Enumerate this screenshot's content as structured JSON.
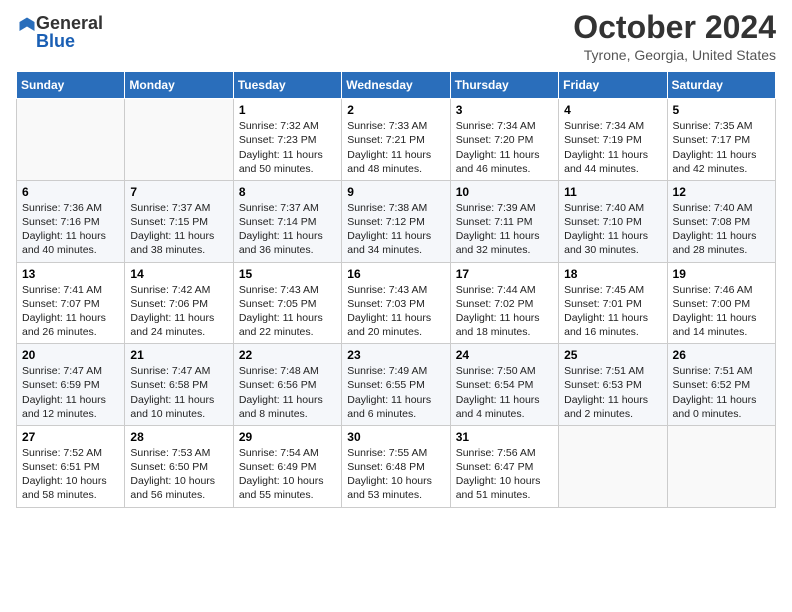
{
  "header": {
    "logo_general": "General",
    "logo_blue": "Blue",
    "month_title": "October 2024",
    "location": "Tyrone, Georgia, United States"
  },
  "days_of_week": [
    "Sunday",
    "Monday",
    "Tuesday",
    "Wednesday",
    "Thursday",
    "Friday",
    "Saturday"
  ],
  "weeks": [
    [
      {
        "day": "",
        "info": ""
      },
      {
        "day": "",
        "info": ""
      },
      {
        "day": "1",
        "info": "Sunrise: 7:32 AM\nSunset: 7:23 PM\nDaylight: 11 hours and 50 minutes."
      },
      {
        "day": "2",
        "info": "Sunrise: 7:33 AM\nSunset: 7:21 PM\nDaylight: 11 hours and 48 minutes."
      },
      {
        "day": "3",
        "info": "Sunrise: 7:34 AM\nSunset: 7:20 PM\nDaylight: 11 hours and 46 minutes."
      },
      {
        "day": "4",
        "info": "Sunrise: 7:34 AM\nSunset: 7:19 PM\nDaylight: 11 hours and 44 minutes."
      },
      {
        "day": "5",
        "info": "Sunrise: 7:35 AM\nSunset: 7:17 PM\nDaylight: 11 hours and 42 minutes."
      }
    ],
    [
      {
        "day": "6",
        "info": "Sunrise: 7:36 AM\nSunset: 7:16 PM\nDaylight: 11 hours and 40 minutes."
      },
      {
        "day": "7",
        "info": "Sunrise: 7:37 AM\nSunset: 7:15 PM\nDaylight: 11 hours and 38 minutes."
      },
      {
        "day": "8",
        "info": "Sunrise: 7:37 AM\nSunset: 7:14 PM\nDaylight: 11 hours and 36 minutes."
      },
      {
        "day": "9",
        "info": "Sunrise: 7:38 AM\nSunset: 7:12 PM\nDaylight: 11 hours and 34 minutes."
      },
      {
        "day": "10",
        "info": "Sunrise: 7:39 AM\nSunset: 7:11 PM\nDaylight: 11 hours and 32 minutes."
      },
      {
        "day": "11",
        "info": "Sunrise: 7:40 AM\nSunset: 7:10 PM\nDaylight: 11 hours and 30 minutes."
      },
      {
        "day": "12",
        "info": "Sunrise: 7:40 AM\nSunset: 7:08 PM\nDaylight: 11 hours and 28 minutes."
      }
    ],
    [
      {
        "day": "13",
        "info": "Sunrise: 7:41 AM\nSunset: 7:07 PM\nDaylight: 11 hours and 26 minutes."
      },
      {
        "day": "14",
        "info": "Sunrise: 7:42 AM\nSunset: 7:06 PM\nDaylight: 11 hours and 24 minutes."
      },
      {
        "day": "15",
        "info": "Sunrise: 7:43 AM\nSunset: 7:05 PM\nDaylight: 11 hours and 22 minutes."
      },
      {
        "day": "16",
        "info": "Sunrise: 7:43 AM\nSunset: 7:03 PM\nDaylight: 11 hours and 20 minutes."
      },
      {
        "day": "17",
        "info": "Sunrise: 7:44 AM\nSunset: 7:02 PM\nDaylight: 11 hours and 18 minutes."
      },
      {
        "day": "18",
        "info": "Sunrise: 7:45 AM\nSunset: 7:01 PM\nDaylight: 11 hours and 16 minutes."
      },
      {
        "day": "19",
        "info": "Sunrise: 7:46 AM\nSunset: 7:00 PM\nDaylight: 11 hours and 14 minutes."
      }
    ],
    [
      {
        "day": "20",
        "info": "Sunrise: 7:47 AM\nSunset: 6:59 PM\nDaylight: 11 hours and 12 minutes."
      },
      {
        "day": "21",
        "info": "Sunrise: 7:47 AM\nSunset: 6:58 PM\nDaylight: 11 hours and 10 minutes."
      },
      {
        "day": "22",
        "info": "Sunrise: 7:48 AM\nSunset: 6:56 PM\nDaylight: 11 hours and 8 minutes."
      },
      {
        "day": "23",
        "info": "Sunrise: 7:49 AM\nSunset: 6:55 PM\nDaylight: 11 hours and 6 minutes."
      },
      {
        "day": "24",
        "info": "Sunrise: 7:50 AM\nSunset: 6:54 PM\nDaylight: 11 hours and 4 minutes."
      },
      {
        "day": "25",
        "info": "Sunrise: 7:51 AM\nSunset: 6:53 PM\nDaylight: 11 hours and 2 minutes."
      },
      {
        "day": "26",
        "info": "Sunrise: 7:51 AM\nSunset: 6:52 PM\nDaylight: 11 hours and 0 minutes."
      }
    ],
    [
      {
        "day": "27",
        "info": "Sunrise: 7:52 AM\nSunset: 6:51 PM\nDaylight: 10 hours and 58 minutes."
      },
      {
        "day": "28",
        "info": "Sunrise: 7:53 AM\nSunset: 6:50 PM\nDaylight: 10 hours and 56 minutes."
      },
      {
        "day": "29",
        "info": "Sunrise: 7:54 AM\nSunset: 6:49 PM\nDaylight: 10 hours and 55 minutes."
      },
      {
        "day": "30",
        "info": "Sunrise: 7:55 AM\nSunset: 6:48 PM\nDaylight: 10 hours and 53 minutes."
      },
      {
        "day": "31",
        "info": "Sunrise: 7:56 AM\nSunset: 6:47 PM\nDaylight: 10 hours and 51 minutes."
      },
      {
        "day": "",
        "info": ""
      },
      {
        "day": "",
        "info": ""
      }
    ]
  ]
}
